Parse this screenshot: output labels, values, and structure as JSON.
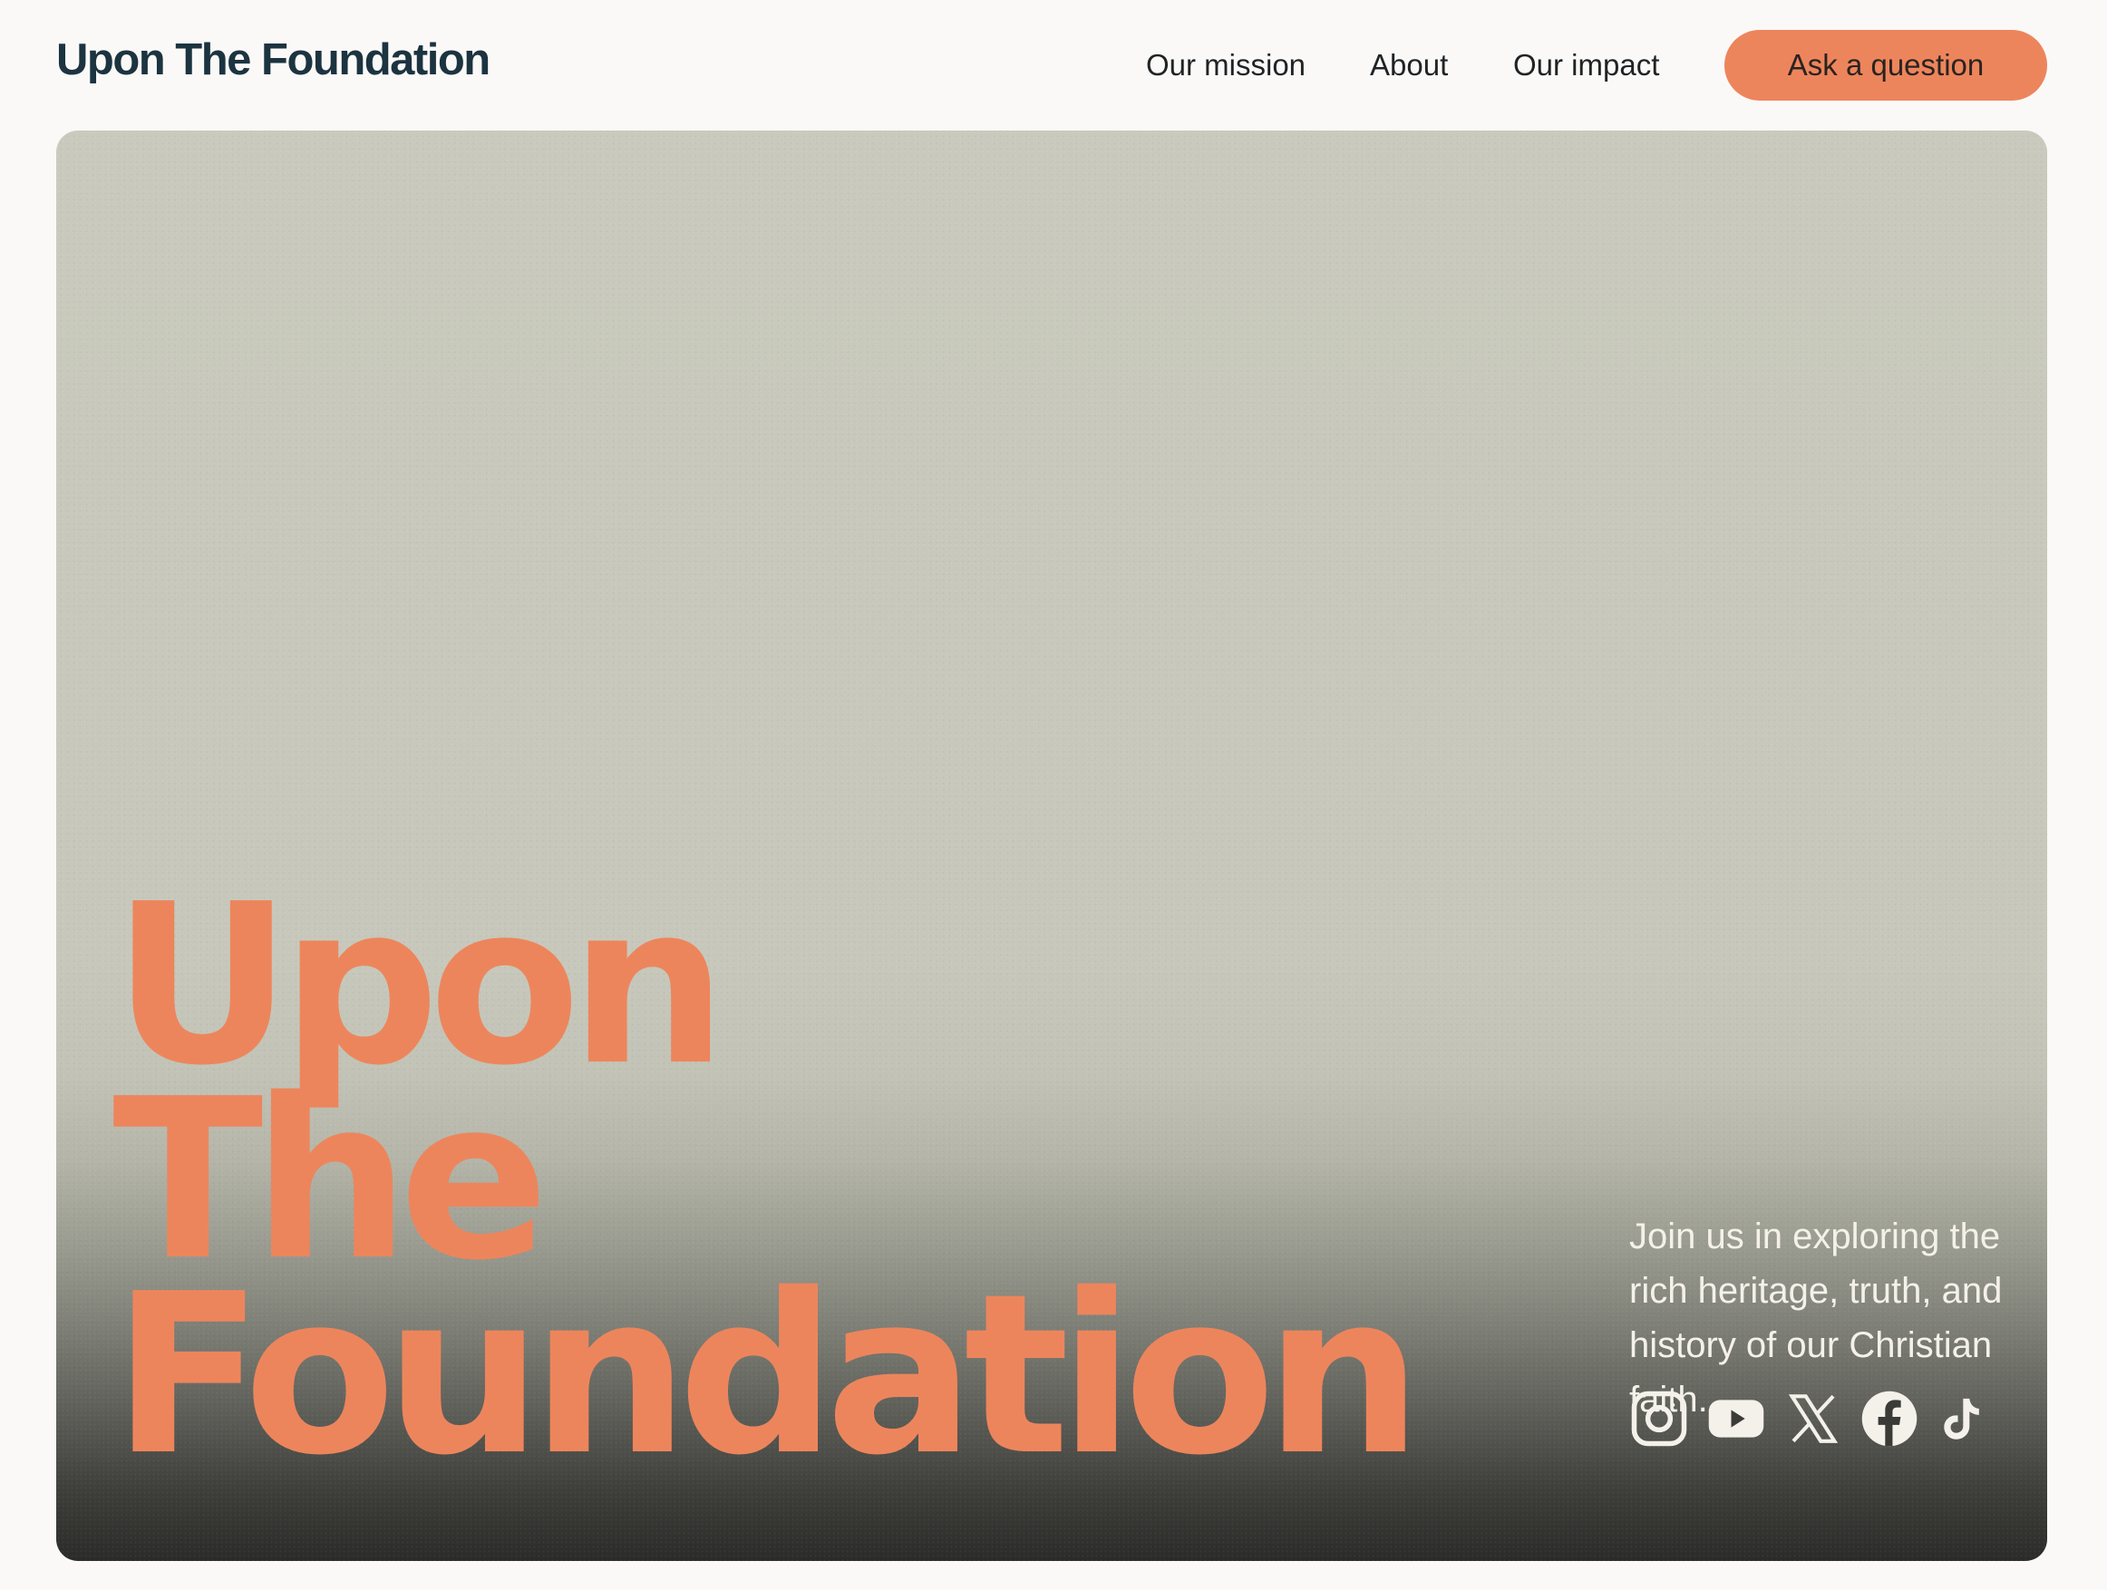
{
  "header": {
    "brand": "Upon The Foundation",
    "nav": [
      {
        "label": "Our mission"
      },
      {
        "label": "About"
      },
      {
        "label": "Our impact"
      }
    ],
    "cta_label": "Ask a question"
  },
  "hero": {
    "headline_lines": [
      "Upon",
      "The",
      "Foundation"
    ],
    "tagline": "Join us in exploring the rich heritage, truth, and history of our Christian faith.",
    "social_icons": [
      "instagram-icon",
      "youtube-icon",
      "x-icon",
      "facebook-icon",
      "tiktok-icon"
    ]
  },
  "colors": {
    "accent": "#ed855c",
    "brand_text": "#1c3340",
    "page_background": "#faf9f7",
    "hero_top": "#c9cabd",
    "hero_bottom": "#2b2c29"
  }
}
